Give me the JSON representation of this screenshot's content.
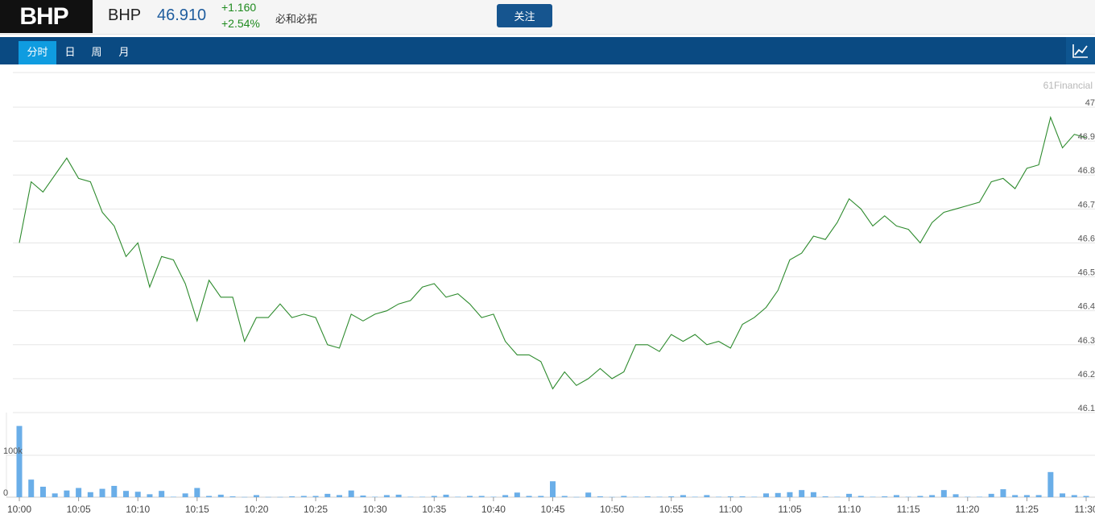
{
  "header": {
    "logo": "BHP",
    "ticker": "BHP",
    "price": "46.910",
    "change": "+1.160",
    "change_pct": "+2.54%",
    "company_name": "必和必拓",
    "follow_label": "关注"
  },
  "tabs": [
    {
      "label": "分时",
      "active": true
    },
    {
      "label": "日",
      "active": false
    },
    {
      "label": "周",
      "active": false
    },
    {
      "label": "月",
      "active": false
    }
  ],
  "chart_icon": "line-chart-icon",
  "colors": {
    "nav": "#0a4a82",
    "active_tab": "#0f9ce0",
    "price_line": "#2e8b2e",
    "volume_bar": "#6aaee8",
    "price_text": "#1f5d9e",
    "change_text": "#1e8a1e"
  },
  "chart_data": [
    {
      "type": "line",
      "watermark": "61Financial",
      "x_ticks": [
        "10:00",
        "10:05",
        "10:10",
        "10:15",
        "10:20",
        "10:25",
        "10:30",
        "10:35",
        "10:40",
        "10:45",
        "10:50",
        "10:55",
        "11:00",
        "11:05",
        "11:10",
        "11:15",
        "11:20",
        "11:25",
        "11:30"
      ],
      "y_ticks": [
        "47",
        "46.9",
        "46.8",
        "46.7",
        "46.6",
        "46.5",
        "46.4",
        "46.3",
        "46.2",
        "46.1"
      ],
      "ylim": [
        46.1,
        47.0
      ],
      "grid": true,
      "series": [
        {
          "values": [
            46.6,
            46.78,
            46.75,
            46.8,
            46.85,
            46.79,
            46.78,
            46.69,
            46.65,
            46.56,
            46.6,
            46.47,
            46.56,
            46.55,
            46.48,
            46.37,
            46.49,
            46.44,
            46.44,
            46.31,
            46.38,
            46.38,
            46.42,
            46.38,
            46.39,
            46.38,
            46.3,
            46.29,
            46.39,
            46.37,
            46.39,
            46.4,
            46.42,
            46.43,
            46.47,
            46.48,
            46.44,
            46.45,
            46.42,
            46.38,
            46.39,
            46.31,
            46.27,
            46.27,
            46.25,
            46.17,
            46.22,
            46.18,
            46.2,
            46.23,
            46.2,
            46.22,
            46.3,
            46.3,
            46.28,
            46.33,
            46.31,
            46.33,
            46.3,
            46.31,
            46.29,
            46.36,
            46.38,
            46.41,
            46.46,
            46.55,
            46.57,
            46.62,
            46.61,
            46.66,
            46.73,
            46.7,
            46.65,
            46.68,
            46.65,
            46.64,
            46.6,
            46.66,
            46.69,
            46.7,
            46.71,
            46.72,
            46.78,
            46.79,
            46.76,
            46.82,
            46.83,
            46.97,
            46.88,
            46.92,
            46.91
          ]
        }
      ]
    },
    {
      "type": "bar",
      "y_ticks": [
        "100k",
        "0"
      ],
      "ylim": [
        0,
        175000
      ],
      "series": [
        {
          "values": [
            170000,
            42000,
            25000,
            9000,
            16000,
            22000,
            12000,
            20000,
            27000,
            15000,
            13000,
            7000,
            15000,
            1000,
            9000,
            22000,
            3000,
            6000,
            2000,
            500,
            5000,
            500,
            500,
            2000,
            3000,
            3000,
            8000,
            5000,
            16000,
            4000,
            1000,
            5000,
            6000,
            1000,
            1000,
            3000,
            6000,
            1000,
            3000,
            3000,
            1000,
            5000,
            11000,
            3000,
            3000,
            38000,
            3000,
            500,
            11000,
            2000,
            500,
            3000,
            1000,
            2000,
            1000,
            2000,
            5000,
            1000,
            5000,
            1000,
            2000,
            2000,
            1000,
            9000,
            10000,
            12000,
            17000,
            12000,
            2000,
            1000,
            8000,
            3000,
            1000,
            2000,
            5000,
            1000,
            3000,
            5000,
            17000,
            7000,
            1000,
            1000,
            8000,
            19000,
            5000,
            5000,
            5000,
            60000,
            9000,
            5000,
            3000
          ]
        }
      ]
    }
  ]
}
